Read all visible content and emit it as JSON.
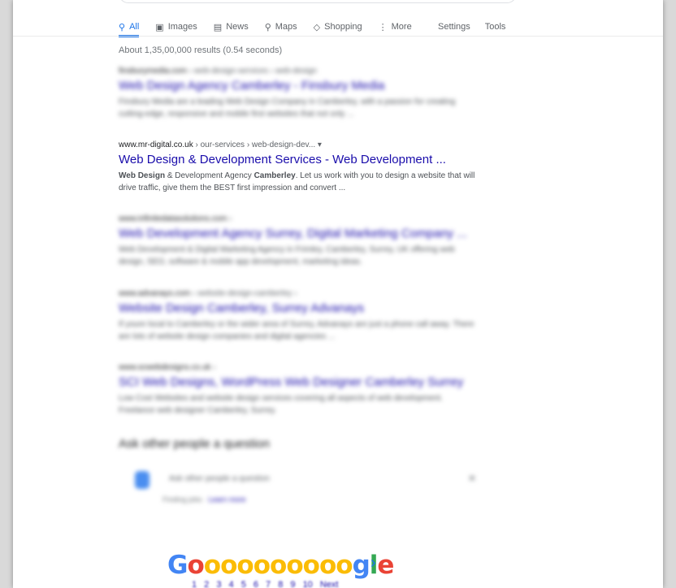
{
  "tabs": [
    {
      "label": "All",
      "icon": "search-icon",
      "glyph": "⚲"
    },
    {
      "label": "Images",
      "icon": "image-icon",
      "glyph": "▣"
    },
    {
      "label": "News",
      "icon": "news-icon",
      "glyph": "▤"
    },
    {
      "label": "Maps",
      "icon": "map-pin-icon",
      "glyph": "⚲"
    },
    {
      "label": "Shopping",
      "icon": "tag-icon",
      "glyph": "◇"
    },
    {
      "label": "More",
      "icon": "more-vert-icon",
      "glyph": "⋮"
    }
  ],
  "tools": {
    "settings": "Settings",
    "tools": "Tools"
  },
  "stats": "About 1,35,00,000 results (0.54 seconds)",
  "results": [
    {
      "domain": "finsburymedia.com",
      "path": " › web-design-services › web-design",
      "title": "Web Design Agency Camberley - Finsbury Media",
      "snippet": "Finsbury Media are a leading Web Design Company in Camberley, with a passion for creating cutting-edge, responsive and mobile first websites that not only ..."
    },
    {
      "domain": "www.mr-digital.co.uk",
      "path": " › our-services › web-design-dev... ▾",
      "title": "Web Design & Development Services - Web Development ...",
      "snippet_bold1": "Web Design",
      "snippet_mid1": " & Development Agency ",
      "snippet_bold2": "Camberley",
      "snippet_rest": ". Let us work with you to design a website that will drive traffic, give them the BEST first impression and convert ..."
    },
    {
      "domain": "www.infinitedatasolutions.com",
      "path": " ›",
      "title": "Web Development Agency Surrey, Digital Marketing Company ...",
      "snippet": "Web Development & Digital Marketing Agency in Frimley, Camberley, Surrey, UK offering web design, SEO, software & mobile app development, marketing ideas."
    },
    {
      "domain": "www.advanays.com",
      "path": " › website-design-camberley ›",
      "title": "Website Design Camberley, Surrey Advanays",
      "snippet": "If youre local to Camberley or the wider area of Surrey, Advanays are just a phone call away. There are lots of website design companies and digital agencies ..."
    },
    {
      "domain": "www.scwebdesigns.co.uk",
      "path": " ›",
      "title": "SCI Web Designs, WordPress Web Designer Camberley Surrey",
      "snippet": "Low Cost Websites and website design services covering all aspects of web development. Freelance web designer Camberley, Surrey."
    }
  ],
  "paa": {
    "title": "Ask other people a question",
    "placeholder": "Ask other people a question",
    "feedback_prefix": "Finding jobs · ",
    "feedback_link": "Learn more"
  },
  "pagination": {
    "logo_letters": [
      "G",
      "o",
      "o",
      "o",
      "o",
      "o",
      "o",
      "o",
      "o",
      "o",
      "o",
      "g",
      "l",
      "e"
    ],
    "pages": "1 2 3 4 5 6 7 8 9 10",
    "next": "Next"
  },
  "colors": {
    "link": "#1a0dab",
    "accent": "#1a73e8",
    "muted": "#70757a"
  }
}
